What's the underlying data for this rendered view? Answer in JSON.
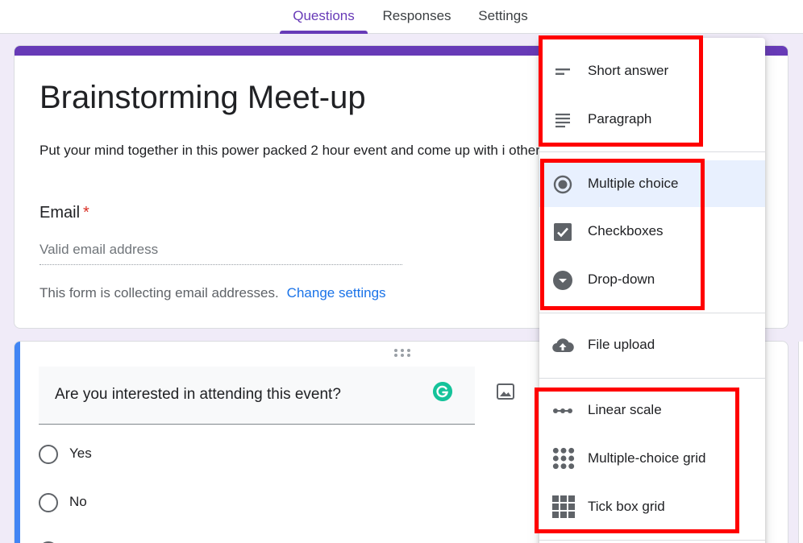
{
  "tabs": [
    {
      "label": "Questions",
      "active": true
    },
    {
      "label": "Responses",
      "active": false
    },
    {
      "label": "Settings",
      "active": false
    }
  ],
  "form": {
    "title": "Brainstorming Meet-up",
    "description": "Put your mind together in this power packed 2 hour event and come up with i otherwise.",
    "email_label": "Email",
    "required_mark": "*",
    "email_placeholder": "Valid email address",
    "collect_note": "This form is collecting email addresses.",
    "change_settings": "Change settings"
  },
  "question": {
    "text": "Are you interested in attending this event?",
    "options": [
      "Yes",
      "No"
    ]
  },
  "menu": {
    "items": [
      {
        "label": "Short answer",
        "icon": "short-answer-icon"
      },
      {
        "label": "Paragraph",
        "icon": "paragraph-icon"
      },
      {
        "label": "Multiple choice",
        "icon": "radio-button-icon",
        "selected": true
      },
      {
        "label": "Checkboxes",
        "icon": "checkbox-icon"
      },
      {
        "label": "Drop-down",
        "icon": "dropdown-circle-icon"
      },
      {
        "label": "File upload",
        "icon": "cloud-upload-icon"
      },
      {
        "label": "Linear scale",
        "icon": "linear-scale-icon"
      },
      {
        "label": "Multiple-choice grid",
        "icon": "dot-grid-icon"
      },
      {
        "label": "Tick box grid",
        "icon": "square-grid-icon"
      }
    ]
  },
  "colors": {
    "accent": "#673ab7",
    "question_accent": "#4285f4",
    "highlight": "#ff0000",
    "link": "#1a73e8",
    "selected_bg": "#e8f0fe"
  }
}
